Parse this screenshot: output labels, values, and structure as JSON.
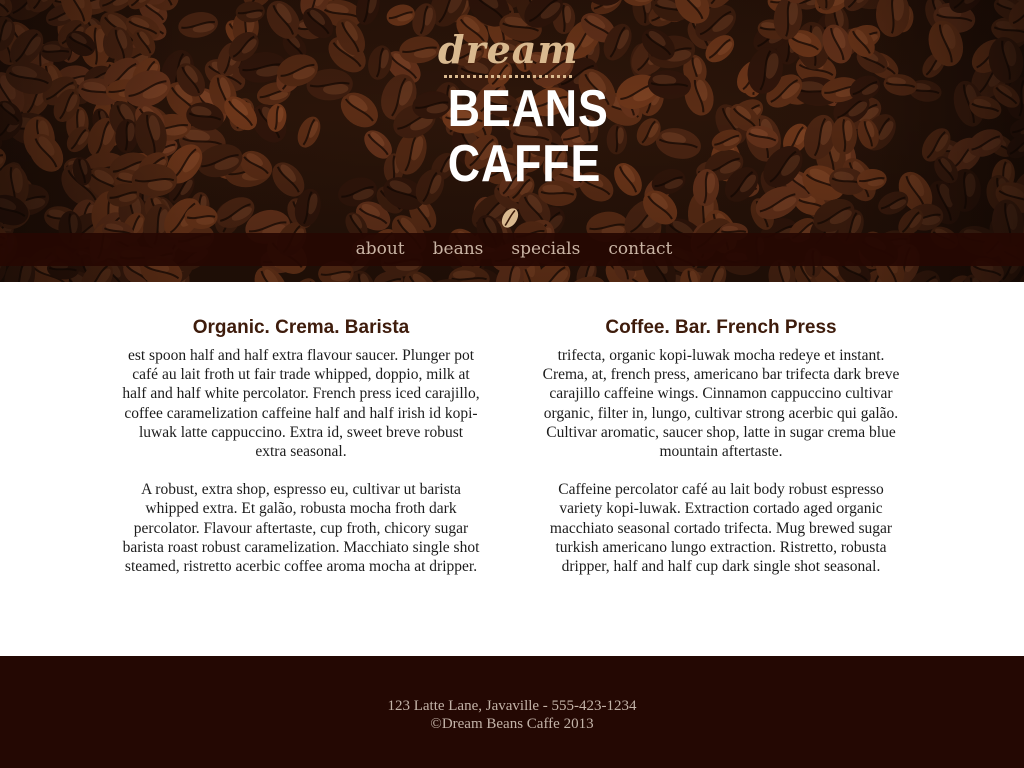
{
  "brand": {
    "line1": "dream",
    "line2": "BEANS",
    "line3": "CAFFE",
    "colors": {
      "dream_tan": "#d9b98f",
      "logo_white": "#ffffff",
      "nav_bar": "#260702",
      "nav_text": "#c9b4a4",
      "heading": "#3e1c0c",
      "footer_bg": "#240803",
      "footer_text": "#c3b3a8"
    },
    "icon": "coffee-bean-icon"
  },
  "nav": {
    "items": [
      {
        "label": "about"
      },
      {
        "label": "beans"
      },
      {
        "label": "specials"
      },
      {
        "label": "contact"
      }
    ]
  },
  "columns": [
    {
      "title": "Organic. Crema. Barista",
      "paragraphs": [
        "est spoon half and half extra flavour saucer. Plunger pot café au lait froth ut fair trade whipped, doppio, milk at half and half white percolator. French press iced carajillo, coffee caramelization caffeine half and half irish id kopi-luwak latte cappuccino. Extra id, sweet breve robust extra seasonal.",
        "A robust, extra shop, espresso eu, cultivar ut barista whipped extra. Et galão, robusta mocha froth dark percolator. Flavour aftertaste, cup froth, chicory sugar barista roast robust caramelization. Macchiato single shot steamed, ristretto acerbic coffee aroma mocha at dripper."
      ]
    },
    {
      "title": "Coffee. Bar. French Press",
      "paragraphs": [
        "trifecta, organic kopi-luwak mocha redeye et instant. Crema, at, french press, americano bar trifecta dark breve carajillo caffeine wings. Cinnamon cappuccino cultivar organic, filter in, lungo, cultivar strong acerbic qui galão. Cultivar aromatic, saucer shop, latte in sugar crema blue mountain aftertaste.",
        "Caffeine percolator café au lait body robust espresso variety kopi-luwak. Extraction cortado aged organic macchiato seasonal cortado trifecta. Mug brewed sugar turkish americano lungo extraction. Ristretto, robusta dripper, half and half cup dark single shot seasonal."
      ]
    }
  ],
  "footer": {
    "address": "123 Latte Lane, Javaville - 555-423-1234",
    "copyright": "©Dream Beans Caffe 2013"
  }
}
